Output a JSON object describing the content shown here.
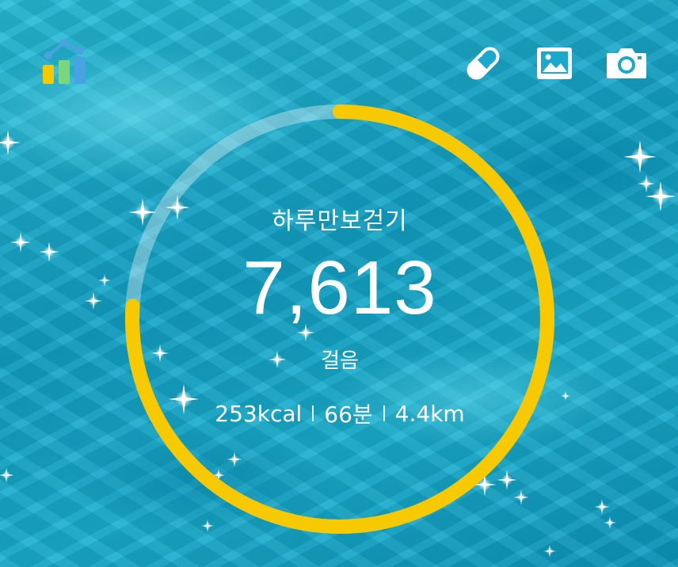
{
  "header": {
    "stats_icon": "bar-chart-icon",
    "actions": [
      {
        "name": "pill",
        "icon": "pill-icon"
      },
      {
        "name": "gallery",
        "icon": "image-icon"
      },
      {
        "name": "camera",
        "icon": "camera-icon"
      }
    ]
  },
  "pedometer": {
    "title": "하루만보걷기",
    "steps": "7,613",
    "steps_unit": "걸음",
    "calories": "253kcal",
    "duration": "66분",
    "distance": "4.4km",
    "progress_fraction": 0.76
  },
  "colors": {
    "progress": "#f7c900",
    "track": "rgba(255,255,255,0.35)",
    "icon_blue": "#4aa3e0",
    "icon_green": "#7cd67c",
    "icon_yellow": "#f7c900"
  }
}
